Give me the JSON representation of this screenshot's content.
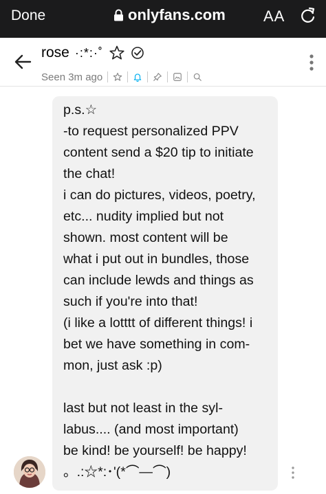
{
  "browser": {
    "done_label": "Done",
    "domain": "onlyfans.com",
    "text_size_label": "AA",
    "lock_icon": "lock-icon",
    "reload_icon": "reload-icon"
  },
  "chat_header": {
    "back_icon": "back-arrow-icon",
    "name": "rose",
    "name_decoration": "·:*:·˚",
    "status": "Seen 3m ago",
    "icons": [
      "star-outline-icon",
      "verified-check-icon",
      "star-icon",
      "bell-icon",
      "pin-icon",
      "gallery-icon",
      "search-icon",
      "more-vertical-icon"
    ],
    "accent_color": "#00aff0"
  },
  "message": {
    "lines": [
      "p.s.☆",
      "-to request personalized PPV",
      "content send a $20 tip to initiate",
      "the chat!",
      "i can do pictures, videos, poetry,",
      "etc... nudity implied but not",
      "shown. most content will be",
      "what i put out in bundles, those",
      "can include lewds and things as",
      "such if you're into that!",
      "(i like a lotttt of different things! i",
      "bet we have something in com-",
      "mon, just ask :p)",
      "",
      "last but not least in the syl-",
      "labus.... (and most important)",
      "be kind! be yourself! be happy!",
      "。.:☆*:･'(*⌒―⌒)"
    ]
  }
}
